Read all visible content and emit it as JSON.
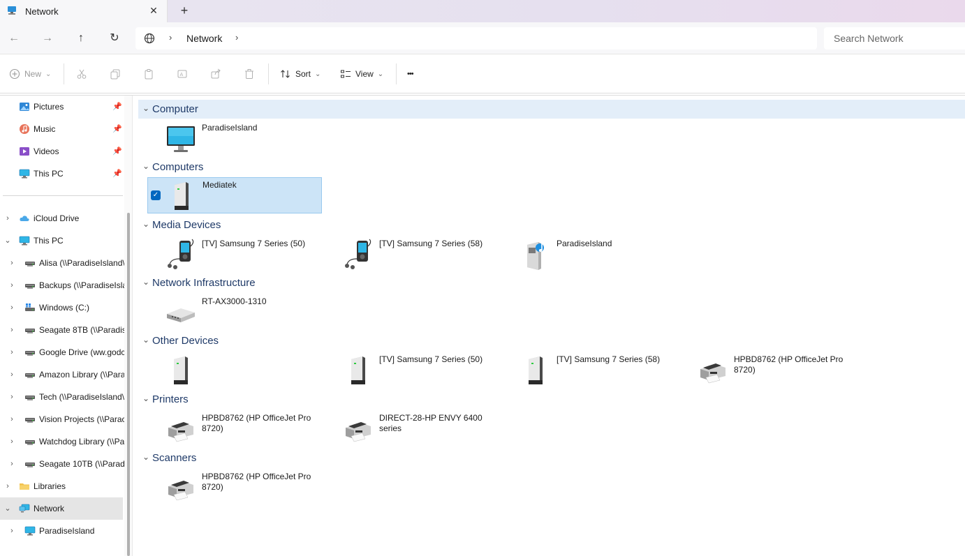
{
  "tab": {
    "title": "Network",
    "close": "✕",
    "add": "+"
  },
  "nav": {
    "back": "←",
    "forward": "→",
    "up": "↑",
    "refresh": "↻"
  },
  "address": {
    "path": "Network",
    "chevron": "›"
  },
  "search": {
    "placeholder": "Search Network"
  },
  "toolbar": {
    "new_label": "New",
    "sort_label": "Sort",
    "view_label": "View",
    "more": "•••",
    "dropdown": "⌄"
  },
  "sidebar": {
    "pinned": [
      {
        "label": "Pictures",
        "icon": "pictures-icon"
      },
      {
        "label": "Music",
        "icon": "music-icon"
      },
      {
        "label": "Videos",
        "icon": "videos-icon"
      },
      {
        "label": "This PC",
        "icon": "this-pc-icon"
      }
    ],
    "tree": [
      {
        "label": "iCloud Drive",
        "chevron": "›"
      },
      {
        "label": "This PC",
        "chevron": "⌄"
      },
      {
        "label": "Alisa (\\\\ParadiseIsland\\",
        "chevron": "›"
      },
      {
        "label": "Backups (\\\\ParadiseIsla",
        "chevron": "›"
      },
      {
        "label": "Windows (C:)",
        "chevron": "›"
      },
      {
        "label": "Seagate 8TB (\\\\Paradise",
        "chevron": "›"
      },
      {
        "label": "Google Drive (ww.godc",
        "chevron": "›"
      },
      {
        "label": "Amazon Library (\\\\Para",
        "chevron": "›"
      },
      {
        "label": "Tech (\\\\ParadiseIsland\\",
        "chevron": "›"
      },
      {
        "label": "Vision Projects (\\\\Parac",
        "chevron": "›"
      },
      {
        "label": "Watchdog Library (\\\\Pa",
        "chevron": "›"
      },
      {
        "label": "Seagate 10TB (\\\\Paradi",
        "chevron": "›"
      },
      {
        "label": "Libraries",
        "chevron": "›"
      },
      {
        "label": "Network",
        "chevron": "⌄"
      },
      {
        "label": "ParadiseIsland",
        "chevron": "›"
      }
    ]
  },
  "groups": {
    "computer": {
      "label": "Computer",
      "items": [
        "ParadiseIsland"
      ]
    },
    "computers": {
      "label": "Computers",
      "items": [
        "Mediatek"
      ],
      "check": "✓"
    },
    "media": {
      "label": "Media Devices",
      "items": [
        "[TV] Samsung 7 Series (50)",
        "[TV] Samsung 7 Series (58)",
        "ParadiseIsland"
      ]
    },
    "infra": {
      "label": "Network Infrastructure",
      "items": [
        "RT-AX3000-1310"
      ]
    },
    "other": {
      "label": "Other Devices",
      "items": [
        "[TV] Samsung 7 Series (50)",
        "[TV] Samsung 7 Series (58)",
        "HPBD8762 (HP OfficeJet Pro 8720)"
      ]
    },
    "printers": {
      "label": "Printers",
      "items": [
        "HPBD8762 (HP OfficeJet Pro 8720)",
        "DIRECT-28-HP ENVY 6400 series"
      ]
    },
    "scanners": {
      "label": "Scanners",
      "items": [
        "HPBD8762 (HP OfficeJet Pro 8720)"
      ]
    },
    "chevron": "⌄"
  },
  "colors": {
    "accent": "#0067c0",
    "selection": "#cce4f7",
    "group_text": "#1f3a68"
  }
}
